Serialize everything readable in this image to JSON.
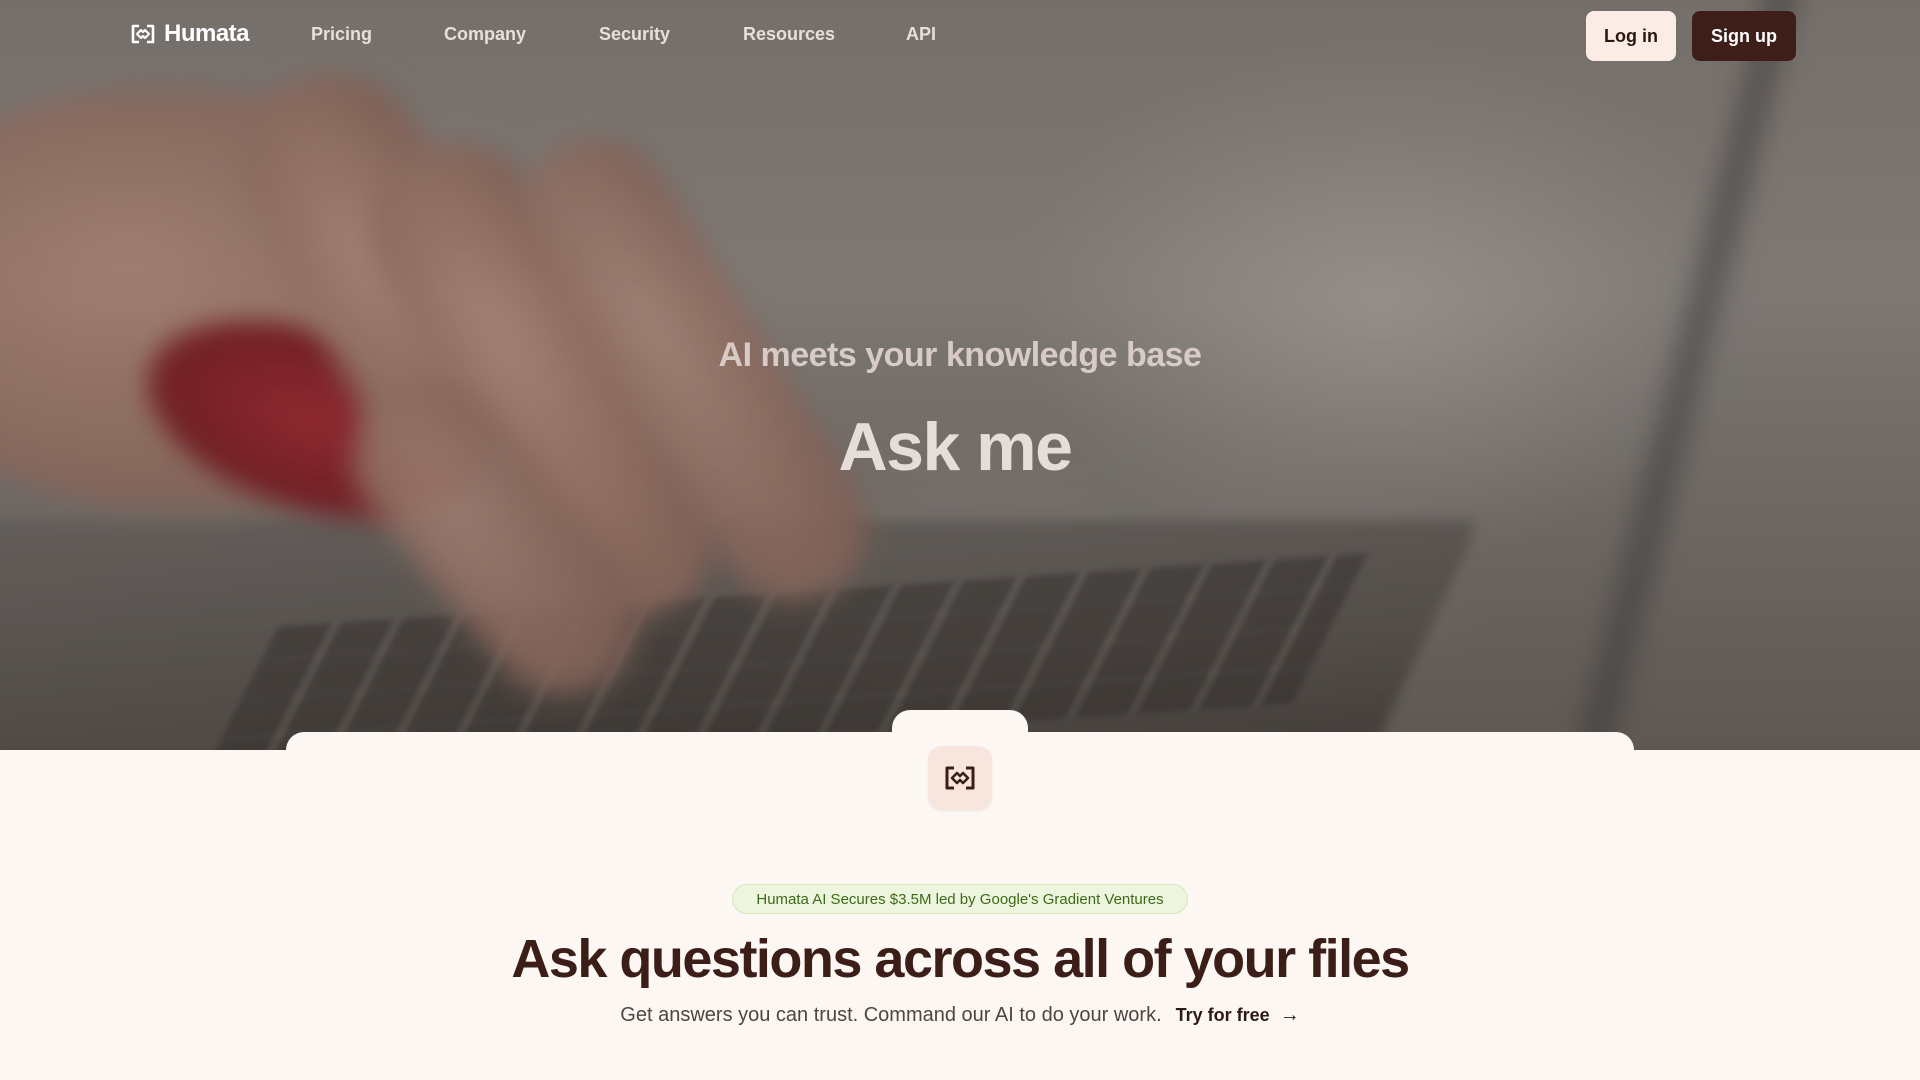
{
  "nav": {
    "brand": "Humata",
    "links": [
      "Pricing",
      "Company",
      "Security",
      "Resources",
      "API"
    ],
    "login_label": "Log in",
    "signup_label": "Sign up"
  },
  "hero": {
    "subtitle": "AI meets your knowledge base",
    "title": "Ask me"
  },
  "section": {
    "badge": "Humata AI Secures $3.5M led by Google's Gradient Ventures",
    "heading": "Ask questions across all of your files",
    "tagline": "Get answers you can trust. Command our AI to do your work.",
    "cta_label": "Try for free",
    "cta_icon": "arrow-right-icon"
  },
  "colors": {
    "brand_dark": "#3e1e19",
    "login_bg": "#fbece6",
    "page_bg": "#fcf7f3",
    "badge_bg": "#eef5de",
    "badge_text": "#3d6a19"
  }
}
